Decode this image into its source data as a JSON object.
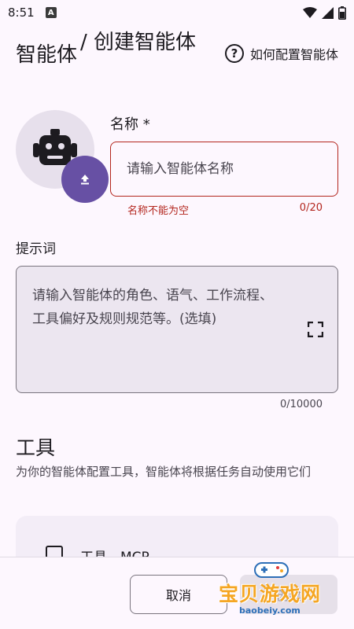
{
  "status_bar": {
    "time": "8:51",
    "notification_glyph": "A"
  },
  "header": {
    "title_main": "智能体",
    "title_sub": "/ 创建智能体",
    "help_label": "如何配置智能体"
  },
  "avatar": {
    "icon": "robot-icon",
    "upload_icon": "upload-icon"
  },
  "name_field": {
    "label": "名称 *",
    "value": "",
    "placeholder": "请输入智能体名称",
    "error": "名称不能为空",
    "counter": "0/20"
  },
  "prompt_field": {
    "label": "提示词",
    "placeholder": "请输入智能体的角色、语气、工作流程、工具偏好及规则规范等。(选填)",
    "counter": "0/10000"
  },
  "tools": {
    "title": "工具",
    "description": "为你的智能体配置工具，智能体将根据任务自动使用它们",
    "items": [
      {
        "label": "工具 - MCP",
        "checked": false
      }
    ]
  },
  "actions": {
    "cancel_label": "取消",
    "create_label": "创建"
  },
  "watermark": {
    "text": "宝贝游戏网",
    "url": "baobeiy.com"
  },
  "colors": {
    "background": "#fdf7fe",
    "primary": "#6750a4",
    "error": "#b3261e",
    "surface_variant": "#ece6f0"
  }
}
